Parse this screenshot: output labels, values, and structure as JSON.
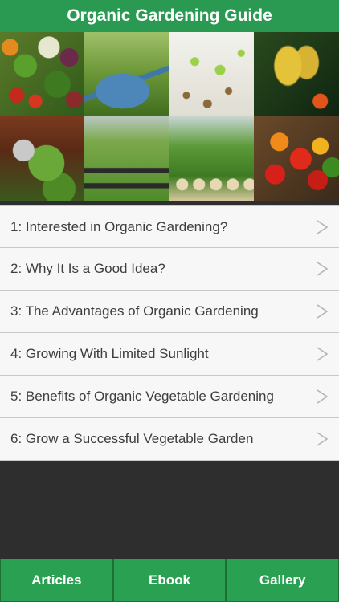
{
  "header": {
    "title": "Organic Gardening Guide"
  },
  "hero": {
    "images": [
      "vegetable-pile-photo",
      "watering-can-photo",
      "seedlings-photo",
      "butterfly-photo",
      "hanging-basket-photo",
      "raised-beds-photo",
      "seedling-trays-photo",
      "tomatoes-photo"
    ]
  },
  "articles": [
    {
      "label": "1: Interested in Organic Gardening?"
    },
    {
      "label": "2: Why It Is a Good Idea?"
    },
    {
      "label": "3: The Advantages of Organic Gardening"
    },
    {
      "label": "4: Growing With Limited Sunlight"
    },
    {
      "label": "5: Benefits of Organic Vegetable Gardening"
    },
    {
      "label": "6: Grow a Successful Vegetable Garden"
    }
  ],
  "chevron_icon": "chevron-right-icon",
  "tabs": [
    {
      "label": "Articles"
    },
    {
      "label": "Ebook"
    },
    {
      "label": "Gallery"
    }
  ],
  "colors": {
    "header": "#2a9a52",
    "tab": "#2aa052",
    "list_bg": "#f7f7f7",
    "page_bg": "#2e2e2e"
  }
}
